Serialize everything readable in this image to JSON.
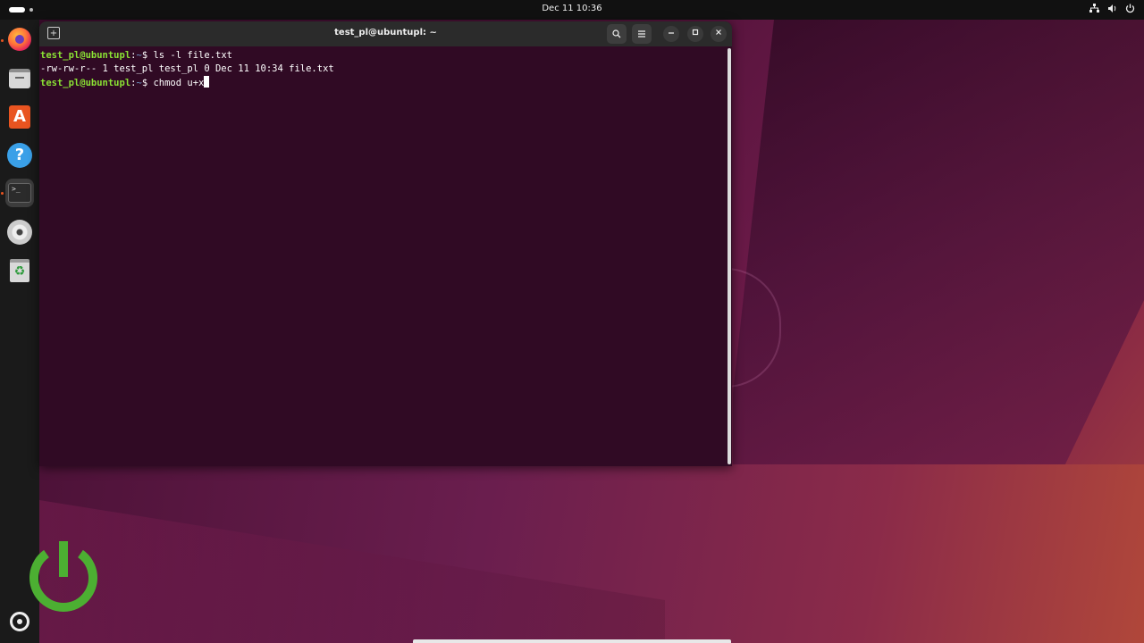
{
  "topbar": {
    "clock": "Dec 11  10:36",
    "tray_icons": [
      "network-icon",
      "volume-icon",
      "power-icon"
    ]
  },
  "dock": {
    "apps": [
      {
        "name": "firefox",
        "icon": "firefox-icon"
      },
      {
        "name": "files",
        "icon": "folder-icon"
      },
      {
        "name": "app-center",
        "icon": "app-center-icon"
      },
      {
        "name": "help",
        "icon": "help-icon"
      },
      {
        "name": "terminal",
        "icon": "terminal-icon",
        "active": true
      },
      {
        "name": "disc",
        "icon": "disc-icon"
      },
      {
        "name": "trash",
        "icon": "trash-icon"
      }
    ],
    "show_apps_icon": "ubuntu-logo-icon"
  },
  "terminal": {
    "title": "test_pl@ubuntupl: ~",
    "lines": [
      {
        "prompt": "test_pl@ubuntupl",
        "sep": ":",
        "path": "~",
        "symbol": "$",
        "command": " ls -l file.txt"
      },
      {
        "output": "-rw-rw-r-- 1 test_pl test_pl 0 Dec 11 10:34 file.txt"
      },
      {
        "prompt": "test_pl@ubuntupl",
        "sep": ":",
        "path": "~",
        "symbol": "$",
        "command": " chmod u+x"
      }
    ]
  },
  "colors": {
    "terminal_bg": "#300a24",
    "prompt_green": "#8ae234",
    "accent": "#e95420",
    "power_logo": "#4caf32"
  }
}
